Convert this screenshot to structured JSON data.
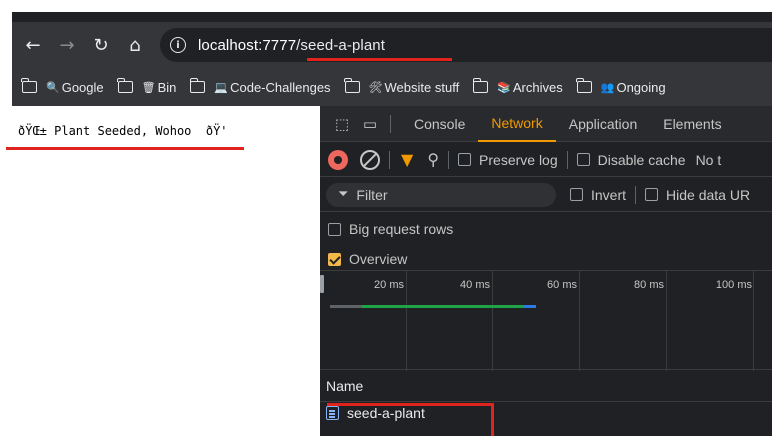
{
  "browser": {
    "url_host": "localhost:7777",
    "url_path": "/seed-a-plant",
    "bookmarks": [
      {
        "glyph": "🔍",
        "label": "Google"
      },
      {
        "glyph": "🗑",
        "label": "Bin"
      },
      {
        "glyph": "💻",
        "label": "Code-Challenges"
      },
      {
        "glyph": "🛠",
        "label": "Website stuff"
      },
      {
        "glyph": "📚",
        "label": "Archives"
      },
      {
        "glyph": "👥",
        "label": "Ongoing"
      }
    ]
  },
  "page": {
    "text": "ðŸŒ± Plant Seeded, Wohoo  ðŸ'"
  },
  "devtools": {
    "tabs": [
      "Console",
      "Network",
      "Application",
      "Elements"
    ],
    "active_tab": "Network",
    "preserve_log": "Preserve log",
    "disable_cache": "Disable cache",
    "no_throttle": "No t",
    "filter_placeholder": "Filter",
    "invert": "Invert",
    "hide_data": "Hide data UR",
    "big_rows": "Big request rows",
    "overview": "Overview",
    "overview_ticks": [
      "20 ms",
      "40 ms",
      "60 ms",
      "80 ms",
      "100 ms"
    ],
    "name_header": "Name",
    "requests": [
      {
        "name": "seed-a-plant"
      }
    ],
    "colors": {
      "accent": "#f29900",
      "record": "#ee675c",
      "bar_waiting": "#1ea446",
      "bar_download": "#2d7ae0"
    }
  }
}
